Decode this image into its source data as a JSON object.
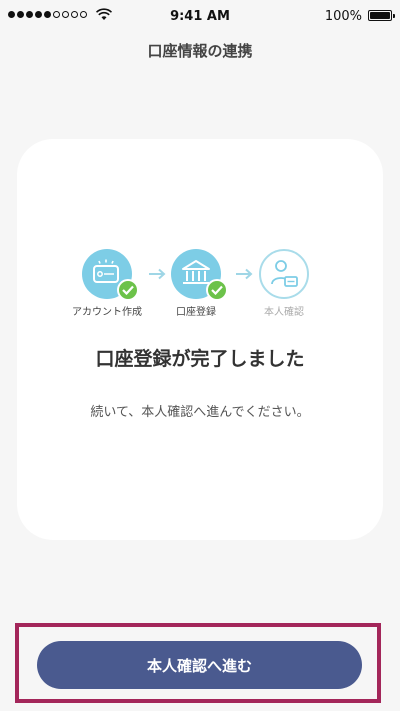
{
  "status_bar": {
    "time": "9:41 AM",
    "battery": "100%"
  },
  "header": {
    "title": "口座情報の連携"
  },
  "steps": [
    {
      "label": "アカウント作成",
      "state": "done",
      "icon": "card-icon"
    },
    {
      "label": "口座登録",
      "state": "done",
      "icon": "bank-icon"
    },
    {
      "label": "本人確認",
      "state": "pending",
      "icon": "person-id-icon"
    }
  ],
  "main": {
    "headline": "口座登録が完了しました",
    "subtext": "続いて、本人確認へ進んでください。"
  },
  "footer": {
    "button_label": "本人確認へ進む"
  },
  "colors": {
    "step_done": "#7dcde6",
    "check": "#6cc24a",
    "button": "#4a5a8f",
    "highlight": "#a3265a"
  }
}
